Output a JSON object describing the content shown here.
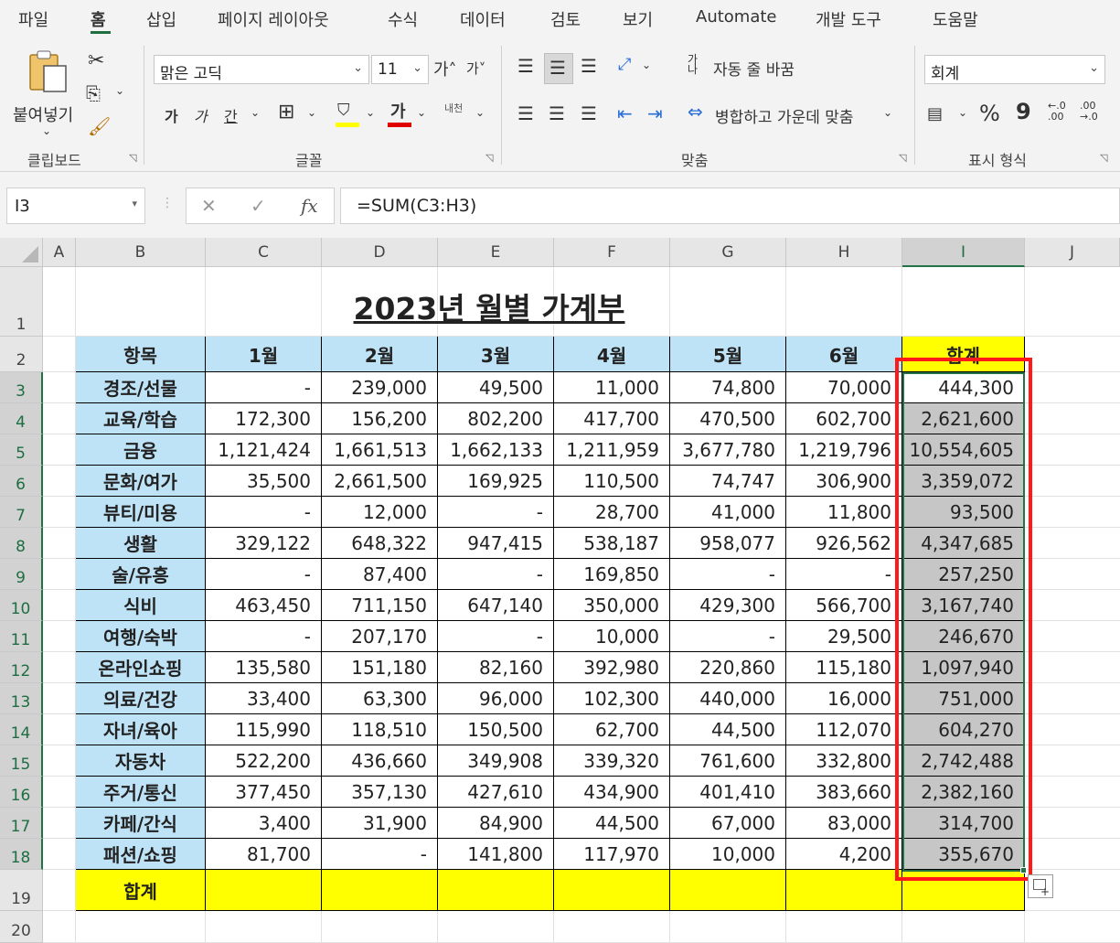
{
  "ribbon_tabs": [
    "파일",
    "홈",
    "삽입",
    "페이지 레이아웃",
    "수식",
    "데이터",
    "검토",
    "보기",
    "Automate",
    "개발 도구",
    "도움말"
  ],
  "active_tab": "홈",
  "clipboard": {
    "paste_label": "붙여넣기",
    "group_label": "클립보드"
  },
  "font": {
    "name": "맑은 고딕",
    "size": "11",
    "bold": "가",
    "italic": "가",
    "underline": "간",
    "font_color_glyph": "가",
    "phonetic": "내천",
    "group_label": "글꼴"
  },
  "alignment": {
    "wrap_text": "자동 줄 바꿈",
    "merge_center": "병합하고 가운데 맞춤",
    "group_label": "맞춤"
  },
  "number": {
    "format": "회계",
    "percent": "%",
    "comma": "9",
    "group_label": "표시 형식"
  },
  "formula_bar": {
    "name_box": "I3",
    "formula": "=SUM(C3:H3)",
    "fx": "fx"
  },
  "columns": [
    "A",
    "B",
    "C",
    "D",
    "E",
    "F",
    "G",
    "H",
    "I",
    "J"
  ],
  "rows": [
    "1",
    "2",
    "3",
    "4",
    "5",
    "6",
    "7",
    "8",
    "9",
    "10",
    "11",
    "12",
    "13",
    "14",
    "15",
    "16",
    "17",
    "18",
    "19",
    "20"
  ],
  "sheet": {
    "title": "2023년 월별 가계부",
    "headers": [
      "항목",
      "1월",
      "2월",
      "3월",
      "4월",
      "5월",
      "6월",
      "합계"
    ],
    "data": [
      [
        "경조/선물",
        "-",
        "239,000",
        "49,500",
        "11,000",
        "74,800",
        "70,000",
        "444,300"
      ],
      [
        "교육/학습",
        "172,300",
        "156,200",
        "802,200",
        "417,700",
        "470,500",
        "602,700",
        "2,621,600"
      ],
      [
        "금융",
        "1,121,424",
        "1,661,513",
        "1,662,133",
        "1,211,959",
        "3,677,780",
        "1,219,796",
        "10,554,605"
      ],
      [
        "문화/여가",
        "35,500",
        "2,661,500",
        "169,925",
        "110,500",
        "74,747",
        "306,900",
        "3,359,072"
      ],
      [
        "뷰티/미용",
        "-",
        "12,000",
        "-",
        "28,700",
        "41,000",
        "11,800",
        "93,500"
      ],
      [
        "생활",
        "329,122",
        "648,322",
        "947,415",
        "538,187",
        "958,077",
        "926,562",
        "4,347,685"
      ],
      [
        "술/유흥",
        "-",
        "87,400",
        "-",
        "169,850",
        "-",
        "-",
        "257,250"
      ],
      [
        "식비",
        "463,450",
        "711,150",
        "647,140",
        "350,000",
        "429,300",
        "566,700",
        "3,167,740"
      ],
      [
        "여행/숙박",
        "-",
        "207,170",
        "-",
        "10,000",
        "-",
        "29,500",
        "246,670"
      ],
      [
        "온라인쇼핑",
        "135,580",
        "151,180",
        "82,160",
        "392,980",
        "220,860",
        "115,180",
        "1,097,940"
      ],
      [
        "의료/건강",
        "33,400",
        "63,300",
        "96,000",
        "102,300",
        "440,000",
        "16,000",
        "751,000"
      ],
      [
        "자녀/육아",
        "115,990",
        "118,510",
        "150,500",
        "62,700",
        "44,500",
        "112,070",
        "604,270"
      ],
      [
        "자동차",
        "522,200",
        "436,660",
        "349,908",
        "339,320",
        "761,600",
        "332,800",
        "2,742,488"
      ],
      [
        "주거/통신",
        "377,450",
        "357,130",
        "427,610",
        "434,900",
        "401,410",
        "383,660",
        "2,382,160"
      ],
      [
        "카페/간식",
        "3,400",
        "31,900",
        "84,900",
        "44,500",
        "67,000",
        "83,000",
        "314,700"
      ],
      [
        "패션/쇼핑",
        "81,700",
        "-",
        "141,800",
        "117,970",
        "10,000",
        "4,200",
        "355,670"
      ]
    ],
    "total_label": "합계"
  },
  "colors": {
    "header_blue": "#bfe3f6",
    "total_yellow": "#ffff00",
    "selection_green": "#217346",
    "annotation_red": "#ff1a1a"
  }
}
